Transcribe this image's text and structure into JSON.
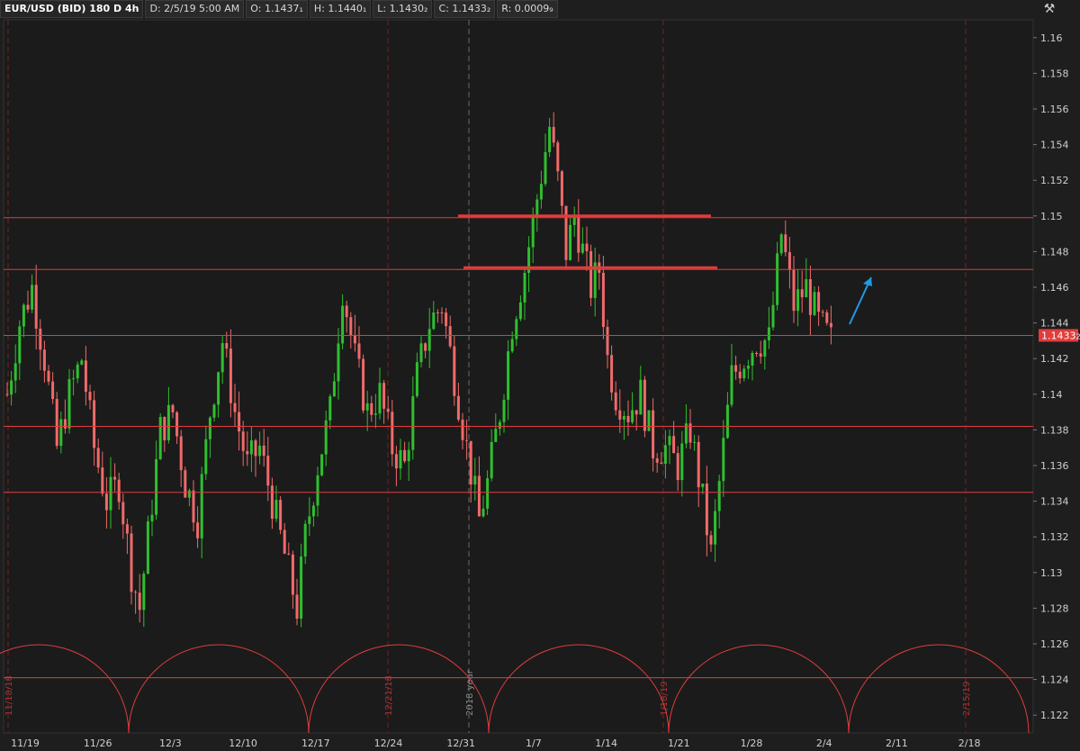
{
  "header": {
    "symbol": "EUR/USD (BID) 180 D 4h",
    "date": "D: 2/5/19 5:00 AM",
    "open": "O: 1.1437₁",
    "high": "H: 1.1440₁",
    "low": "L: 1.1430₂",
    "close": "C: 1.1433₂",
    "range": "R: 0.0009₉"
  },
  "icons": {
    "settings": "style-tool-icon",
    "alert": "alert-icon"
  },
  "colors": {
    "up": "#2fbf2f",
    "down": "#f06a6a",
    "line": "#e23c3c",
    "price_tag": "#e23c3c",
    "arrow": "#1e9be8",
    "grid": "#7a2222"
  },
  "chart_data": {
    "type": "candlestick",
    "symbol": "EUR/USD",
    "timeframe": "4h",
    "ylim": [
      1.121,
      1.161
    ],
    "yticks": [
      1.16,
      1.158,
      1.156,
      1.154,
      1.152,
      1.15,
      1.148,
      1.146,
      1.144,
      1.142,
      1.14,
      1.138,
      1.136,
      1.134,
      1.132,
      1.13,
      1.128,
      1.126,
      1.124,
      1.122
    ],
    "xticks": [
      "11/19",
      "11/26",
      "12/3",
      "12/10",
      "12/17",
      "12/24",
      "12/31",
      "1/7",
      "1/14",
      "1/21",
      "1/28",
      "2/4",
      "2/11",
      "2/18"
    ],
    "current_price": "1.1433",
    "current_price_suffix": "2",
    "horizontal_levels": [
      1.1499,
      1.147,
      1.1433,
      1.1382,
      1.1345,
      1.1241
    ],
    "trend_segments": [
      {
        "from_date": "12/31",
        "to_date": "1/21",
        "price": 1.15
      },
      {
        "from_date": "12/31",
        "to_date": "1/21",
        "price": 1.1471
      }
    ],
    "vertical_markers": [
      {
        "label": "11/18/18",
        "style": "red"
      },
      {
        "label": "12/21/18",
        "style": "red"
      },
      {
        "label": "2018 year",
        "style": "gray"
      },
      {
        "label": "1/18/19",
        "style": "red"
      },
      {
        "label": "2/15/19",
        "style": "red"
      }
    ],
    "cycle_arcs": 6,
    "price_path": [
      [
        0,
        1.14
      ],
      [
        3,
        1.144
      ],
      [
        6,
        1.146
      ],
      [
        9,
        1.142
      ],
      [
        12,
        1.137
      ],
      [
        15,
        1.14
      ],
      [
        18,
        1.142
      ],
      [
        21,
        1.137
      ],
      [
        24,
        1.134
      ],
      [
        27,
        1.135
      ],
      [
        30,
        1.13
      ],
      [
        32,
        1.128
      ],
      [
        34,
        1.132
      ],
      [
        37,
        1.138
      ],
      [
        40,
        1.139
      ],
      [
        43,
        1.135
      ],
      [
        46,
        1.133
      ],
      [
        49,
        1.139
      ],
      [
        52,
        1.143
      ],
      [
        55,
        1.139
      ],
      [
        58,
        1.136
      ],
      [
        61,
        1.137
      ],
      [
        64,
        1.134
      ],
      [
        67,
        1.131
      ],
      [
        70,
        1.128
      ],
      [
        72,
        1.132
      ],
      [
        75,
        1.136
      ],
      [
        78,
        1.139
      ],
      [
        81,
        1.146
      ],
      [
        84,
        1.142
      ],
      [
        87,
        1.139
      ],
      [
        90,
        1.14
      ],
      [
        93,
        1.137
      ],
      [
        96,
        1.136
      ],
      [
        99,
        1.141
      ],
      [
        102,
        1.144
      ],
      [
        105,
        1.145
      ],
      [
        108,
        1.141
      ],
      [
        111,
        1.137
      ],
      [
        114,
        1.133
      ],
      [
        116,
        1.135
      ],
      [
        119,
        1.139
      ],
      [
        122,
        1.144
      ],
      [
        125,
        1.147
      ],
      [
        128,
        1.151
      ],
      [
        131,
        1.155
      ],
      [
        133,
        1.152
      ],
      [
        135,
        1.148
      ],
      [
        137,
        1.15
      ],
      [
        139,
        1.148
      ],
      [
        141,
        1.146
      ],
      [
        143,
        1.147
      ],
      [
        145,
        1.142
      ],
      [
        147,
        1.14
      ],
      [
        150,
        1.139
      ],
      [
        153,
        1.14
      ],
      [
        156,
        1.137
      ],
      [
        159,
        1.137
      ],
      [
        162,
        1.136
      ],
      [
        165,
        1.138
      ],
      [
        168,
        1.134
      ],
      [
        170,
        1.131
      ],
      [
        172,
        1.135
      ],
      [
        175,
        1.141
      ],
      [
        178,
        1.142
      ],
      [
        181,
        1.143
      ],
      [
        184,
        1.143
      ],
      [
        187,
        1.149
      ],
      [
        190,
        1.145
      ],
      [
        193,
        1.146
      ],
      [
        196,
        1.144
      ],
      [
        199,
        1.143
      ]
    ]
  }
}
